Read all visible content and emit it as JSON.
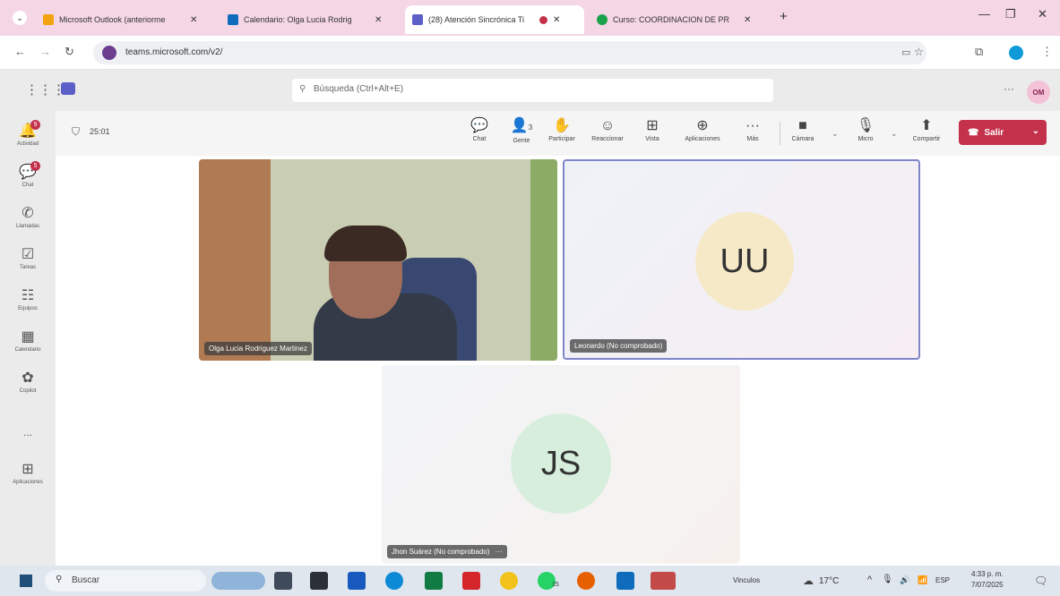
{
  "browser": {
    "tabs": [
      {
        "title": "Microsoft Outlook (anteriorme",
        "color": "#f2a30f"
      },
      {
        "title": "Calendario: Olga Lucia Rodrig",
        "color": "#0f6cbd"
      },
      {
        "title": "(28) Atención Sincrónica Ti",
        "color": "#5b5fc7",
        "active": true
      },
      {
        "title": "Curso: COORDINACION DE PR",
        "color": "#1aa34a"
      }
    ],
    "url": "teams.microsoft.com/v2/"
  },
  "teams": {
    "search_placeholder": "Búsqueda (Ctrl+Alt+E)",
    "user_initials": "OM",
    "rail": [
      {
        "label": "Actividad",
        "icon": "bell-icon",
        "badge": "9"
      },
      {
        "label": "Chat",
        "icon": "chat-icon",
        "badge": "5"
      },
      {
        "label": "Llamadas",
        "icon": "phone-icon"
      },
      {
        "label": "Tareas",
        "icon": "tasks-icon"
      },
      {
        "label": "Equipos",
        "icon": "teams-icon"
      },
      {
        "label": "Calendario",
        "icon": "calendar-icon"
      },
      {
        "label": "Copilot",
        "icon": "copilot-icon"
      },
      {
        "label": "...",
        "icon": "more-icon"
      },
      {
        "label": "Aplicaciones",
        "icon": "apps-icon"
      }
    ],
    "meeting": {
      "timer": "25:01",
      "tools": [
        {
          "label": "Chat",
          "icon": "chat-icon"
        },
        {
          "label": "Gente",
          "icon": "people-icon",
          "count": "3"
        },
        {
          "label": "Participar",
          "icon": "raise-hand-icon"
        },
        {
          "label": "Reaccionar",
          "icon": "smile-icon"
        },
        {
          "label": "Vista",
          "icon": "grid-icon"
        },
        {
          "label": "Aplicaciones",
          "icon": "apps-icon"
        },
        {
          "label": "Más",
          "icon": "more-icon"
        }
      ],
      "media": [
        {
          "label": "Cámara",
          "icon": "camera-icon"
        },
        {
          "label": "Micro",
          "icon": "mic-icon"
        },
        {
          "label": "Compartir",
          "icon": "share-icon"
        }
      ],
      "leave_label": "Salir",
      "participants": [
        {
          "name": "Olga Lucia Rodriguez Martinez",
          "video": true
        },
        {
          "name": "Leonardo (No comprobado)",
          "initials": "UU",
          "avatar_color": "#f6e9c8"
        },
        {
          "name": "Jhon Suárez (No comprobado)",
          "initials": "JS",
          "avatar_color": "#d7eedd"
        }
      ]
    }
  },
  "taskbar": {
    "search_label": "Buscar",
    "tray": {
      "news": "Vinculos",
      "weather": "17°C",
      "language": "ESP",
      "time": "4:33 p. m.",
      "date": "7/07/2025",
      "app_badge": "15"
    }
  }
}
